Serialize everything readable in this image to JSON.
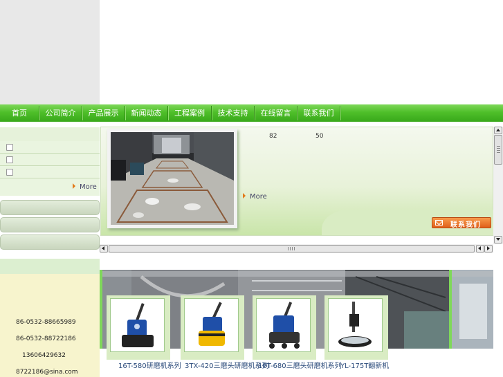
{
  "nav": {
    "items": [
      "首页",
      "公司简介",
      "产品展示",
      "新闻动态",
      "工程案例",
      "技术支持",
      "在线留言",
      "联系我们"
    ]
  },
  "left": {
    "more_label": "More"
  },
  "feature": {
    "stat_a": "82",
    "stat_b": "50",
    "more_label": "More",
    "contact_button": "联系我们"
  },
  "contact": {
    "phone1": "86-0532-88665989",
    "phone2": "86-0532-88722186",
    "mobile": "13606429632",
    "email": "8722186@sina.com"
  },
  "products": [
    {
      "name": "16T-580研磨机系列"
    },
    {
      "name": "3TX-420三磨头研磨机系列"
    },
    {
      "name": "16T-680三磨头研磨机系列"
    },
    {
      "name": "YL-175T翻新机"
    }
  ],
  "colors": {
    "nav_green": "#4fbf2a",
    "accent_orange": "#e27a1a",
    "contact_bg": "#f7f4cd"
  }
}
